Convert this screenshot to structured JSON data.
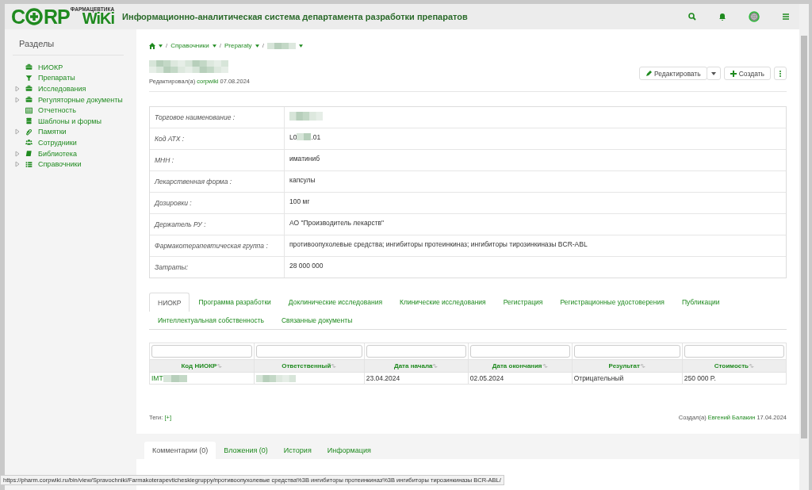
{
  "header": {
    "logo": {
      "first": "C",
      "rest": "RP",
      "wiki": "WiKi",
      "tagline": "ФАРМАЦЕВТИКА"
    },
    "title": "Информационно-аналитическая система департамента разработки препаратов"
  },
  "sidebar": {
    "title": "Разделы",
    "items": [
      {
        "label": "НИОКР",
        "kind": "briefcase",
        "expandable": false
      },
      {
        "label": "Препараты",
        "kind": "filter",
        "expandable": false
      },
      {
        "label": "Исследования",
        "kind": "briefcase",
        "expandable": true
      },
      {
        "label": "Регуляторные документы",
        "kind": "briefcase",
        "expandable": true
      },
      {
        "label": "Отчетность",
        "kind": "table",
        "expandable": false
      },
      {
        "label": "Шаблоны и формы",
        "kind": "database",
        "expandable": false
      },
      {
        "label": "Памятки",
        "kind": "paperclip",
        "expandable": true
      },
      {
        "label": "Сотрудники",
        "kind": "users",
        "expandable": false
      },
      {
        "label": "Библиотека",
        "kind": "book",
        "expandable": true
      },
      {
        "label": "Справочники",
        "kind": "list",
        "expandable": true
      }
    ]
  },
  "breadcrumbs": [
    {
      "kind": "home"
    },
    {
      "kind": "separator",
      "label": "/"
    },
    {
      "label": "Справочники",
      "kind": "link"
    },
    {
      "kind": "separator",
      "label": "/"
    },
    {
      "label": "Preparaty",
      "kind": "link"
    },
    {
      "kind": "separator",
      "label": "/"
    },
    {
      "kind": "blurred"
    }
  ],
  "page": {
    "edited_prefix": "Редактировал(а)",
    "edited_by": "corpwiki",
    "edited_date": "07.08.2024"
  },
  "actions": [
    {
      "label": "Редактировать",
      "kind": "edit"
    },
    {
      "kind": "caret"
    },
    {
      "label": "Создать",
      "kind": "create"
    },
    {
      "kind": "more"
    }
  ],
  "details": [
    {
      "label": "Торговое наименование :",
      "kind": "blurred"
    },
    {
      "label": "Код АТХ :",
      "value": "L0",
      "suffix": ".01",
      "kind": "partly_blurred"
    },
    {
      "label": "МНН :",
      "value": "иматиниб",
      "kind": "text"
    },
    {
      "label": "Лекарственная форма :",
      "value": "капсулы",
      "kind": "text"
    },
    {
      "label": "Дозировки :",
      "value": "100 мг",
      "kind": "text"
    },
    {
      "label": "Держатель РУ :",
      "value": "АО \"Производитель лекарств\"",
      "kind": "text"
    },
    {
      "label": "Фармакотерапевтическая группа :",
      "value": "противоопухолевые средства; ингибиторы протеинкиназ; ингибиторы тирозинкиназы BCR-ABL",
      "kind": "text"
    },
    {
      "label": "Затраты:",
      "value": "28 000 000",
      "kind": "text"
    }
  ],
  "tabs": [
    {
      "label": "НИОКР",
      "selected": true
    },
    {
      "label": "Программа разработки",
      "selected": false
    },
    {
      "label": "Доклинические исследования",
      "selected": false
    },
    {
      "label": "Клинические исследования",
      "selected": false
    },
    {
      "label": "Регистрация",
      "selected": false
    },
    {
      "label": "Регистрационные удостоверения",
      "selected": false
    },
    {
      "label": "Публикации",
      "selected": false
    },
    {
      "label": "Интеллектуальная собственность",
      "selected": false
    },
    {
      "label": "Связанные документы",
      "selected": false
    }
  ],
  "table": {
    "columns": [
      "Код НИОКР",
      "Ответственный",
      "Дата начала",
      "Дата окончания",
      "Результат",
      "Стоимость"
    ],
    "rows": [
      [
        {
          "text": "IMT",
          "kind": "link_blurred"
        },
        {
          "kind": "blurred"
        },
        {
          "text": "23.04.2024",
          "kind": "text"
        },
        {
          "text": "02.05.2024",
          "kind": "text"
        },
        {
          "text": "Отрицательный",
          "kind": "text"
        },
        {
          "text": "250 000 P.",
          "kind": "text"
        }
      ]
    ]
  },
  "footer": {
    "tags_label": "Теги:",
    "tags_add": "[+]",
    "created_prefix": "Создал(а)",
    "created_by": "Евгений Балакин",
    "created_date": "17.04.2024"
  },
  "bottom_tabs": [
    {
      "label": "Комментарии (0)",
      "selected": true
    },
    {
      "label": "Вложения (0)",
      "selected": false
    },
    {
      "label": "История",
      "selected": false
    },
    {
      "label": "Информация",
      "selected": false
    }
  ],
  "status_bar": {
    "url": "https://pharm.corpwiki.ru/bin/view/Spravochniki/Farmakoterapevticheskiegruppy/противоопухолевые средства%3B ингибиторы протеинкиназ%3B ингибиторы тирозинкиназы BCR-ABL/"
  }
}
